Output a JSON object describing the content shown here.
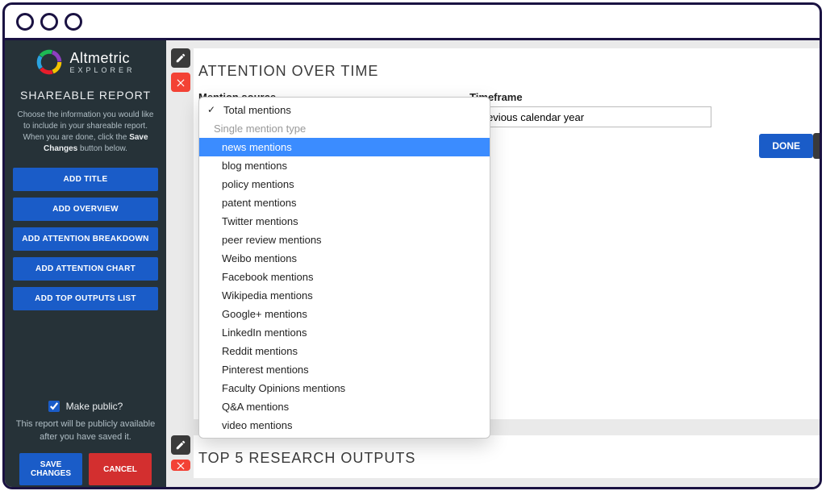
{
  "brand": {
    "name": "Altmetric",
    "subtitle": "EXPLORER"
  },
  "sidebar": {
    "title": "SHAREABLE REPORT",
    "desc_pre": "Choose the information you would like to include in your shareable report. When you are done, click the ",
    "desc_bold": "Save Changes",
    "desc_post": " button below.",
    "buttons": [
      "ADD TITLE",
      "ADD OVERVIEW",
      "ADD ATTENTION BREAKDOWN",
      "ADD ATTENTION CHART",
      "ADD TOP OUTPUTS LIST"
    ],
    "make_public_label": "Make public?",
    "public_note": "This report will be publicly available after you have saved it.",
    "save_label": "SAVE CHANGES",
    "cancel_label": "CANCEL"
  },
  "panel1": {
    "heading": "ATTENTION OVER TIME",
    "mention_label": "Mention source",
    "timeframe_label": "Timeframe",
    "timeframe_value": "Previous calendar year",
    "done_label": "DONE",
    "dropdown": {
      "selected": "Total mentions",
      "group_label": "Single mention type",
      "highlighted": "news mentions",
      "options": [
        "news mentions",
        "blog mentions",
        "policy mentions",
        "patent mentions",
        "Twitter mentions",
        "peer review mentions",
        "Weibo mentions",
        "Facebook mentions",
        "Wikipedia mentions",
        "Google+ mentions",
        "LinkedIn mentions",
        "Reddit mentions",
        "Pinterest mentions",
        "Faculty Opinions mentions",
        "Q&A mentions",
        "video mentions"
      ]
    }
  },
  "panel2": {
    "heading": "TOP 5 RESEARCH OUTPUTS"
  }
}
